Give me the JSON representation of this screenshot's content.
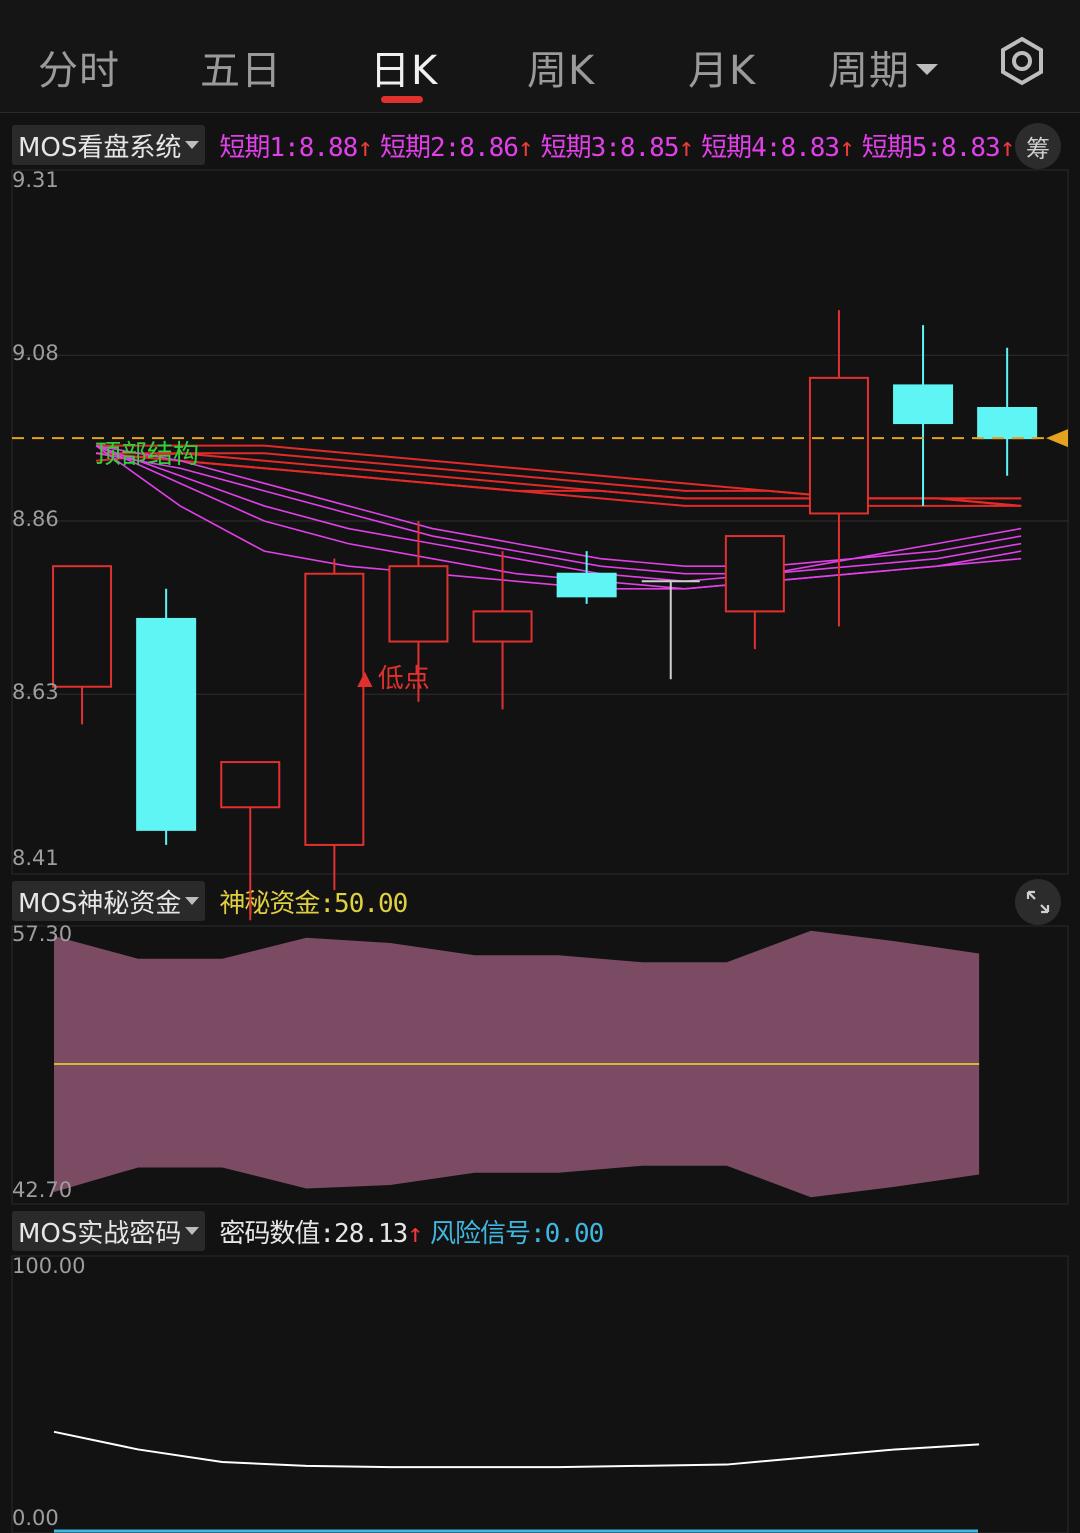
{
  "tabs": [
    {
      "label": "分时",
      "active": false
    },
    {
      "label": "五日",
      "active": false
    },
    {
      "label": "日K",
      "active": true
    },
    {
      "label": "周K",
      "active": false
    },
    {
      "label": "月K",
      "active": false
    },
    {
      "label": "周期",
      "active": false,
      "dropdown": true
    }
  ],
  "settings_icon": "gear-icon",
  "colors": {
    "up": "#e0312f",
    "down": "#5ff5f5",
    "doji": "#cfcfcf",
    "ma_red": "#e22a2a",
    "ma_magenta": "#e040e8",
    "price_line": "#e5a21f",
    "fund_fill": "#7b4b63",
    "fund_line": "#d6b832",
    "code_line": "#ffffff",
    "label_green": "#2fd23a",
    "pink": "#e040e8",
    "yellow": "#e0d040",
    "cyan": "#3fb6e0"
  },
  "main": {
    "selector_label": "MOS看盘系统",
    "indicators": [
      {
        "label": "短期1:8.88",
        "arrow": "↑"
      },
      {
        "label": "短期2:8.86",
        "arrow": "↑"
      },
      {
        "label": "短期3:8.85",
        "arrow": "↑"
      },
      {
        "label": "短期4:8.83",
        "arrow": "↑"
      },
      {
        "label": "短期5:8.83",
        "arrow": "↑"
      }
    ],
    "chip_button": "筹",
    "annotations": {
      "top": "顶部结构",
      "low": "▲低点"
    }
  },
  "fund": {
    "selector_label": "MOS神秘资金",
    "indicator": "神秘资金:50.00",
    "expand_icon": "expand-icon"
  },
  "code": {
    "selector_label": "MOS实战密码",
    "value_label": "密码数值:28.13",
    "value_arrow": "↑",
    "risk_label": "风险信号:0.00"
  },
  "chart_data": [
    {
      "type": "candlestick",
      "ylim": [
        8.41,
        9.31
      ],
      "y_ticks": [
        "9.31",
        "9.08",
        "8.86",
        "8.63",
        "8.41"
      ],
      "grid": true,
      "current_price": 8.97,
      "candles": [
        {
          "open": 8.64,
          "close": 8.8,
          "high": 8.8,
          "low": 8.59
        },
        {
          "open": 8.73,
          "close": 8.45,
          "high": 8.77,
          "low": 8.43
        },
        {
          "open": 8.54,
          "close": 8.48,
          "high": 8.54,
          "low": 8.33
        },
        {
          "open": 8.43,
          "close": 8.79,
          "high": 8.81,
          "low": 8.37
        },
        {
          "open": 8.8,
          "close": 8.7,
          "high": 8.86,
          "low": 8.62
        },
        {
          "open": 8.74,
          "close": 8.7,
          "high": 8.82,
          "low": 8.61
        },
        {
          "open": 8.79,
          "close": 8.76,
          "high": 8.82,
          "low": 8.75
        },
        {
          "open": 8.78,
          "close": 8.78,
          "high": 8.78,
          "low": 8.65
        },
        {
          "open": 8.74,
          "close": 8.84,
          "high": 8.84,
          "low": 8.69
        },
        {
          "open": 8.87,
          "close": 9.05,
          "high": 9.14,
          "low": 8.72
        },
        {
          "open": 9.04,
          "close": 8.99,
          "high": 9.12,
          "low": 8.88
        },
        {
          "open": 9.01,
          "close": 8.97,
          "high": 9.09,
          "low": 8.92
        }
      ],
      "series": [
        {
          "values": [
            8.96,
            8.96,
            8.96,
            8.95,
            8.94,
            8.93,
            8.92,
            8.91,
            8.9,
            8.89,
            8.89,
            8.88
          ]
        },
        {
          "values": [
            8.95,
            8.95,
            8.95,
            8.94,
            8.93,
            8.92,
            8.91,
            8.9,
            8.9,
            8.89,
            8.89,
            8.88
          ]
        },
        {
          "values": [
            8.94,
            8.95,
            8.94,
            8.93,
            8.92,
            8.91,
            8.9,
            8.89,
            8.89,
            8.89,
            8.89,
            8.89
          ]
        },
        {
          "values": [
            8.95,
            8.94,
            8.93,
            8.92,
            8.91,
            8.9,
            8.89,
            8.88,
            8.88,
            8.88,
            8.88,
            8.88
          ]
        },
        {
          "values": [
            8.95,
            8.94,
            8.93,
            8.92,
            8.91,
            8.9,
            8.9,
            8.89,
            8.89,
            8.89,
            8.89,
            8.89
          ]
        },
        {
          "values": [
            8.96,
            8.94,
            8.91,
            8.88,
            8.85,
            8.83,
            8.81,
            8.8,
            8.8,
            8.81,
            8.83,
            8.85
          ]
        },
        {
          "values": [
            8.95,
            8.93,
            8.9,
            8.87,
            8.84,
            8.82,
            8.8,
            8.79,
            8.79,
            8.81,
            8.82,
            8.84
          ]
        },
        {
          "values": [
            8.96,
            8.92,
            8.88,
            8.85,
            8.83,
            8.81,
            8.79,
            8.78,
            8.79,
            8.8,
            8.81,
            8.83
          ]
        },
        {
          "values": [
            8.96,
            8.91,
            8.86,
            8.83,
            8.81,
            8.79,
            8.78,
            8.77,
            8.78,
            8.79,
            8.8,
            8.82
          ]
        },
        {
          "values": [
            8.96,
            8.88,
            8.82,
            8.8,
            8.79,
            8.78,
            8.77,
            8.77,
            8.78,
            8.79,
            8.8,
            8.81
          ]
        }
      ]
    },
    {
      "type": "area",
      "ylim": [
        42.7,
        57.3
      ],
      "y_ticks": [
        "57.30",
        "42.70"
      ],
      "upper": [
        57.3,
        56.0,
        56.0,
        57.2,
        56.9,
        56.2,
        56.2,
        55.8,
        55.8,
        57.6,
        57.0,
        56.3
      ],
      "lower": [
        42.7,
        44.1,
        44.1,
        42.9,
        43.1,
        43.8,
        43.8,
        44.2,
        44.2,
        42.4,
        43.0,
        43.7
      ],
      "mid": [
        50.0,
        50.0,
        50.0,
        50.0,
        50.0,
        50.0,
        50.0,
        50.0,
        50.0,
        50.0,
        50.0,
        50.0
      ]
    },
    {
      "type": "line",
      "ylim": [
        0,
        100
      ],
      "y_ticks": [
        "100.00",
        "0.00"
      ],
      "values": [
        35,
        28,
        23,
        21.5,
        21,
        21,
        21,
        21.5,
        22,
        25,
        28,
        30
      ]
    }
  ]
}
